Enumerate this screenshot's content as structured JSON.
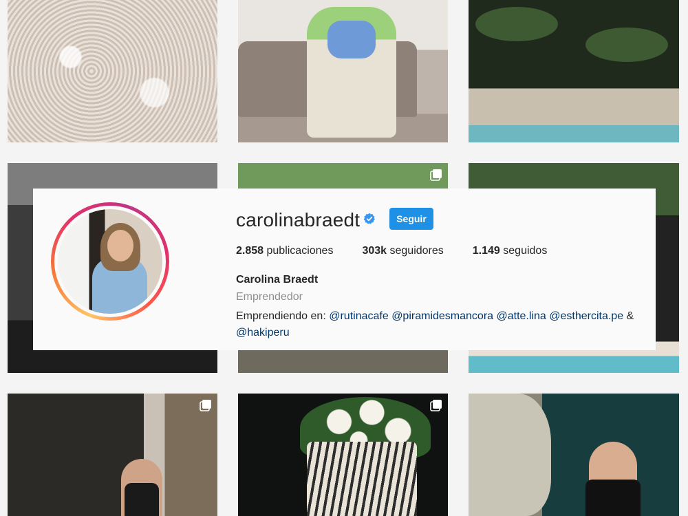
{
  "profile": {
    "username": "carolinabraedt",
    "verified_icon": "verified-badge-icon",
    "follow_label": "Seguir",
    "stats": {
      "posts_count": "2.858",
      "posts_label": "publicaciones",
      "followers_count": "303k",
      "followers_label": "seguidores",
      "following_count": "1.149",
      "following_label": "seguidos"
    },
    "full_name": "Carolina Braedt",
    "category": "Emprendedor",
    "bio_prefix": "Emprendiendo en:",
    "mentions": [
      "@rutinacafe",
      "@piramidesmancora",
      "@atte.lina",
      "@esthercita.pe",
      "@hakiperu"
    ],
    "bio_amp": "&"
  },
  "colors": {
    "follow_button": "#1e90e6",
    "mention_link": "#00376b",
    "verified_badge": "#3897f0",
    "background": "#f4f4f4"
  },
  "grid": {
    "multi_post_icon": "carousel-icon"
  }
}
